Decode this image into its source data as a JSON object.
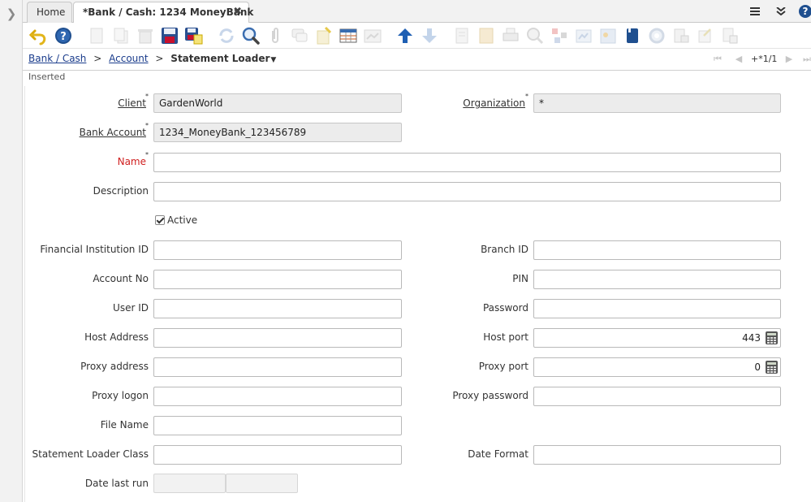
{
  "tabs": {
    "home_label": "Home",
    "active_label": "*Bank / Cash: 1234 MoneyBank",
    "close_symbol": "✖"
  },
  "topbar": {
    "menu_icon": "hamburger-icon",
    "collapse_icon": "double-chevron-down-icon",
    "help_label": "?"
  },
  "toolbar": {
    "icons": [
      "undo-icon",
      "help-icon",
      "new-record-icon",
      "copy-record-icon",
      "delete-icon",
      "save-icon",
      "save-and-create-icon",
      "refresh-icon",
      "find-icon",
      "attachment-icon",
      "chat-icon",
      "report-icon",
      "grid-toggle-icon",
      "zoom-across-icon",
      "parent-record-icon",
      "detail-record-icon",
      "archive-icon",
      "print-preview-icon",
      "print-icon",
      "product-info-icon",
      "workflow-icon",
      "archived-documents-icon",
      "translate-icon",
      "process-icon",
      "request-icon",
      "lock-icon",
      "export-icon"
    ]
  },
  "breadcrumb": {
    "root": "Bank / Cash",
    "parent": "Account",
    "current": "Statement Loader",
    "separator": ">"
  },
  "navigation": {
    "record_count": "+*1/1"
  },
  "status": {
    "text": "Inserted"
  },
  "form": {
    "client": {
      "label": "Client",
      "value": "GardenWorld"
    },
    "organization": {
      "label": "Organization",
      "value": "*"
    },
    "bank_account": {
      "label": "Bank Account",
      "value": "1234_MoneyBank_123456789"
    },
    "name": {
      "label": "Name",
      "value": ""
    },
    "description": {
      "label": "Description",
      "value": ""
    },
    "active": {
      "label": "Active",
      "checked": true
    },
    "financial_institution_id": {
      "label": "Financial Institution ID",
      "value": ""
    },
    "branch_id": {
      "label": "Branch ID",
      "value": ""
    },
    "account_no": {
      "label": "Account No",
      "value": ""
    },
    "pin": {
      "label": "PIN",
      "value": ""
    },
    "user_id": {
      "label": "User ID",
      "value": ""
    },
    "password": {
      "label": "Password",
      "value": ""
    },
    "host_address": {
      "label": "Host Address",
      "value": ""
    },
    "host_port": {
      "label": "Host port",
      "value": "443"
    },
    "proxy_address": {
      "label": "Proxy address",
      "value": ""
    },
    "proxy_port": {
      "label": "Proxy port",
      "value": "0"
    },
    "proxy_logon": {
      "label": "Proxy logon",
      "value": ""
    },
    "proxy_password": {
      "label": "Proxy password",
      "value": ""
    },
    "file_name": {
      "label": "File Name",
      "value": ""
    },
    "statement_loader_class": {
      "label": "Statement Loader Class",
      "value": ""
    },
    "date_format": {
      "label": "Date Format",
      "value": ""
    },
    "date_last_run": {
      "label": "Date last run",
      "date": "",
      "time": ""
    }
  },
  "required_marker": "*",
  "colors": {
    "link": "#1a3c8c",
    "mandatory_label": "#d02020",
    "readonly_field": "#ececec",
    "save_icon": "#2a4f8f",
    "nav_arrow_up": "#1f5fb3"
  }
}
